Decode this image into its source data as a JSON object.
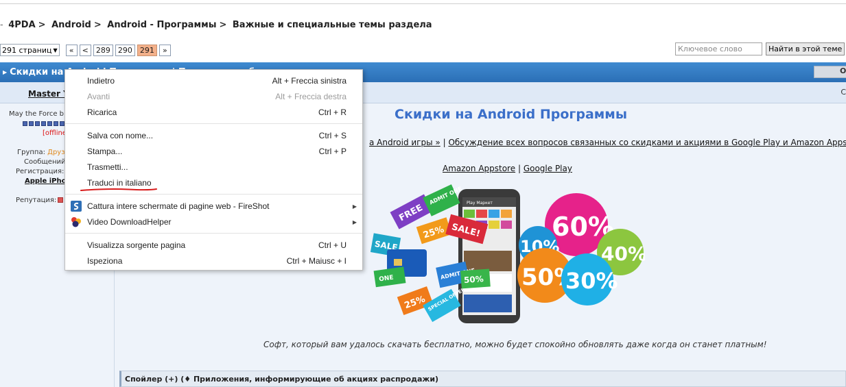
{
  "breadcrumb": {
    "items": [
      "4PDA",
      "Android",
      "Android - Программы",
      "Важные и специальные темы раздела"
    ],
    "separator": ">",
    "prefix_arrow": "-"
  },
  "pager": {
    "pages_select": "291 страниц",
    "first": "«",
    "prev": "<",
    "pages": [
      "289",
      "290",
      "291"
    ],
    "current_page": "291",
    "next": "»"
  },
  "search": {
    "placeholder": "Ключевое слово",
    "button": "Найти в этой теме"
  },
  "topic": {
    "title": "Скидки на Android Программы | Полезное сообщество",
    "options_label": "О"
  },
  "post": {
    "author": "Master Y",
    "date": "С",
    "title": "Скидки на Android Программы",
    "links_line1": [
      "a Android игры »",
      "Обсуждение всех вопросов связанных со скидками и акциями в Google Play и Amazon Appsto"
    ],
    "links_line2": [
      "Amazon Appstore",
      "Google Play"
    ],
    "links_separator": "|",
    "caption": "Софт, который вам удалось скачать бесплатно, можно будет спокойно обновлять даже когда он станет платным!",
    "spoiler": "Спойлер (+) (♦ Приложения, информирующие об акциях распродажи)"
  },
  "promo": {
    "tags": [
      "FREE",
      "25%",
      "ADMIT ONE",
      "SALE!",
      "SALE",
      "25%",
      "SPECIAL OFFER",
      "ADMIT ONE",
      "ONE",
      "50%"
    ],
    "bubbles": [
      "60%",
      "10%",
      "40%",
      "50%",
      "30%"
    ],
    "phone_header": "Play Маркет"
  },
  "sidebar": {
    "status": "May the Force b",
    "online": "[offline",
    "group_label": "Группа:",
    "group_value": "Друз",
    "posts_label": "Сообщений",
    "reg_label": "Регистрация:",
    "device": "Apple iPho",
    "rep_label": "Репутация:"
  },
  "context_menu": {
    "items": [
      {
        "label": "Indietro",
        "shortcut": "Alt + Freccia sinistra",
        "disabled": false
      },
      {
        "label": "Avanti",
        "shortcut": "Alt + Freccia destra",
        "disabled": true
      },
      {
        "label": "Ricarica",
        "shortcut": "Ctrl + R",
        "disabled": false
      },
      {
        "label": "Salva con nome...",
        "shortcut": "Ctrl + S",
        "disabled": false
      },
      {
        "label": "Stampa...",
        "shortcut": "Ctrl + P",
        "disabled": false
      },
      {
        "label": "Trasmetti...",
        "shortcut": "",
        "disabled": false
      },
      {
        "label": "Traduci in italiano",
        "shortcut": "",
        "disabled": false
      },
      {
        "label": "Cattura intere schermate di pagine web - FireShot",
        "shortcut": "",
        "icon": "fireshot-icon",
        "submenu": true
      },
      {
        "label": "Video DownloadHelper",
        "shortcut": "",
        "icon": "downloadhelper-icon",
        "submenu": true
      },
      {
        "label": "Visualizza sorgente pagina",
        "shortcut": "Ctrl + U",
        "disabled": false
      },
      {
        "label": "Ispeziona",
        "shortcut": "Ctrl + Maiusc + I",
        "disabled": false
      }
    ],
    "submenu_glyph": "▶"
  },
  "colors": {
    "topic_bar": "#2f78c0",
    "post_title": "#3b6fc9",
    "active_page": "#f3b08a",
    "annotation_underline": "#d81b1b"
  }
}
